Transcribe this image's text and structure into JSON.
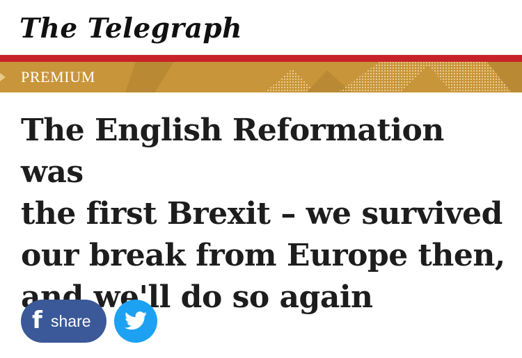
{
  "masthead": {
    "brand": "The Telegraph"
  },
  "banner": {
    "label": "PREMIUM"
  },
  "article": {
    "headline_lines": [
      "The English Reformation was",
      "the first Brexit – we survived",
      "our break from Europe then,",
      "and we'll do so again"
    ]
  },
  "social": {
    "share_label": "share",
    "facebook_glyph": "f"
  },
  "colors": {
    "accent_red": "#c7222a",
    "premium_gold": "#c9953a",
    "facebook_blue": "#3b5998",
    "twitter_blue": "#1da1f2"
  }
}
